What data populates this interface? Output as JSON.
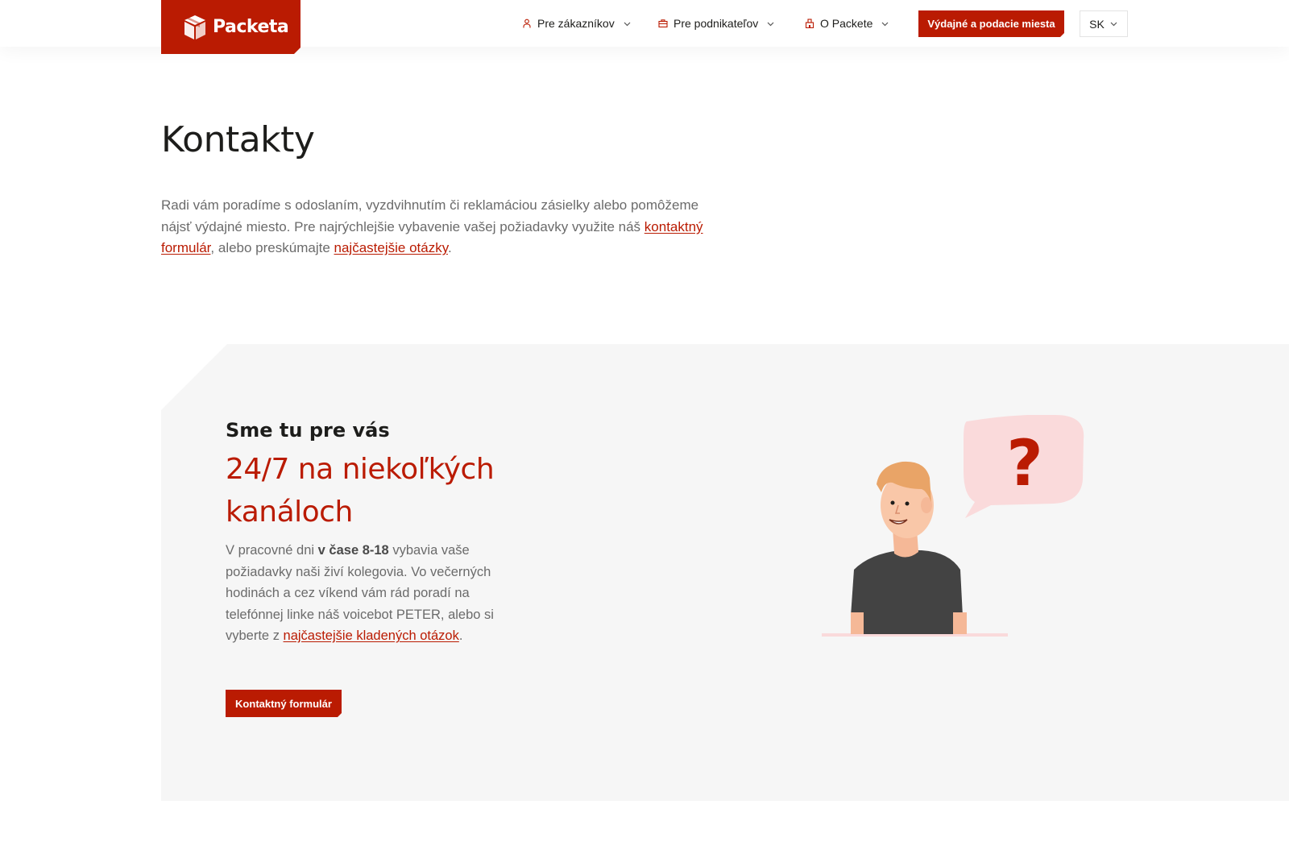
{
  "brand": {
    "name": "Packeta",
    "color": "#ba1b02"
  },
  "nav": {
    "items": [
      {
        "label": "Pre zákazníkov",
        "icon": "person-icon"
      },
      {
        "label": "Pre podnikateľov",
        "icon": "briefcase-icon"
      },
      {
        "label": "O Packete",
        "icon": "building-icon"
      }
    ],
    "cta_label": "Výdajné a podacie miesta",
    "language": "SK"
  },
  "hero": {
    "title": "Kontakty",
    "intro_before": "Radi vám poradíme s odoslaním, vyzdvihnutím či reklamáciou zásielky alebo pomôžeme nájsť výdajné miesto. Pre najrýchlejšie vybavenie vašej požiadavky využite náš ",
    "intro_link1": "kontaktný formulár",
    "intro_middle": ", alebo preskúmajte ",
    "intro_link2": "najčastejšie otázky",
    "intro_end": "."
  },
  "support": {
    "eyebrow": "Sme tu pre vás",
    "headline": "24/7 na niekoľkých kanáloch",
    "body_start": "V pracovné dni ",
    "body_bold": "v čase 8-18",
    "body_middle": " vybavia vaše požiadavky naši živí kolegovia. Vo večerných hodinách a cez víkend vám rád poradí na telefónnej linke náš voicebot PETER, alebo si vyberte z ",
    "body_link": "najčastejšie kladených otázok",
    "body_end": ".",
    "button_label": "Kontaktný formulár",
    "illustration_question_mark": "?"
  }
}
